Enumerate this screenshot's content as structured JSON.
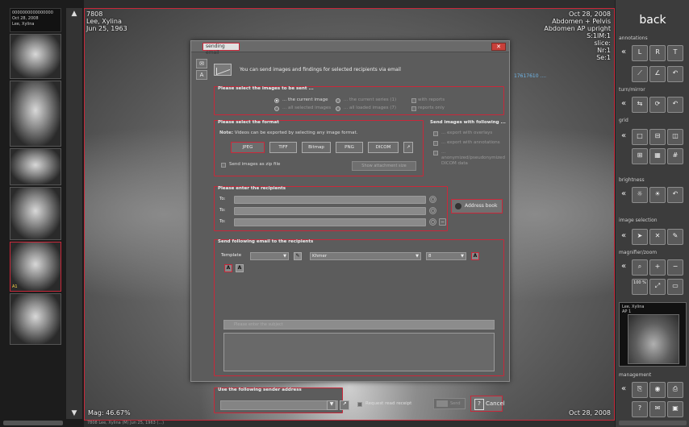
{
  "strip": {
    "info_lines": [
      "0000000000000000",
      "Oct 28, 2008",
      "Lee, Xylina"
    ],
    "scroll_up": "▲",
    "scroll_down": "▼",
    "active_marker": "A1"
  },
  "viewer": {
    "top_left": [
      "7808",
      "Lee, Xylina",
      "Jun 25, 1963"
    ],
    "top_right": [
      "Oct 28, 2008",
      "Abdomen + Pelvis",
      "Abdomen AP upright",
      "S:1IM:1",
      "slice:",
      "Nr:1",
      "Se:1"
    ],
    "magnification": "Mag: 46.67%",
    "bottom_right_date": "Oct 28, 2008",
    "bottom_line": "7808 Lee, Xylina (M) Jun 25, 1963 (...)",
    "measure_label": "17617610 ...."
  },
  "toolbar": {
    "back_label": "back",
    "sections": {
      "annotations": "annotations",
      "turn_mirror": "turn/mirror",
      "grid": "grid",
      "brightness": "brightness",
      "image_selection": "image selection",
      "magnifier_zoom": "magnifier/zoom",
      "management": "management"
    },
    "zoom_100": "100 %",
    "preview_lines": [
      "Lee, Xylina",
      "AP 1"
    ]
  },
  "dialog": {
    "title": "sending email",
    "close_label": "✕",
    "intro": "You can send images and findings for selected recipients via email",
    "images_section": {
      "title": "Please select the images to be sent ...",
      "options": [
        "... the current image",
        "... the current series (1)",
        "with reports",
        "... all selected images",
        "... all loaded images (7)",
        "reports only"
      ]
    },
    "format_section": {
      "title": "Please select the format",
      "note_bold": "Note:",
      "note_text": " Videos can be exported by selecting any image format.",
      "formats": [
        "JPEG",
        "TIFF",
        "Bitmap",
        "PNG",
        "DICOM"
      ],
      "zip_label": "Send images as zip file",
      "show_attachment": "Show attachment size"
    },
    "send_with_section": {
      "title": "Send images with following ...",
      "options": [
        "... export with overlays",
        "... export with annotations",
        "... anonymized/pseudonymized DICOM data"
      ]
    },
    "recipients_section": {
      "title": "Please enter the recipients",
      "rows": [
        "To:",
        "To:",
        "To:"
      ],
      "address_book": "Address book"
    },
    "email_section": {
      "title": "Send following email to the recipients",
      "template_label": "Template",
      "font_value": "Khmer",
      "size_value": "8",
      "subject_placeholder": "Please enter the subject"
    },
    "sender_section": {
      "title": "Use the following sender address"
    },
    "read_receipt": "Request read receipt",
    "send_label": "Send",
    "cancel_label": "Cancel"
  }
}
